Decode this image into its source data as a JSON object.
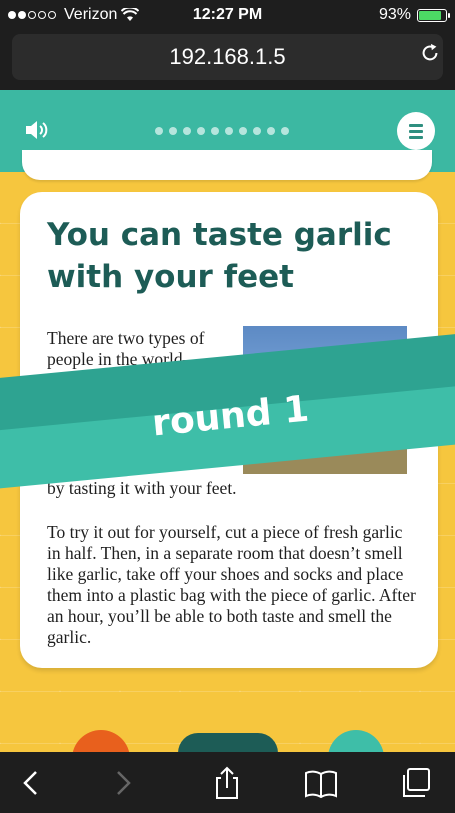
{
  "status_bar": {
    "carrier": "Verizon",
    "time": "12:27 PM",
    "battery": "93%",
    "battery_level": 0.93
  },
  "browser": {
    "address": "192.168.1.5"
  },
  "app_header": {
    "progress_steps": 10
  },
  "card": {
    "title": "You can taste garlic with your feet",
    "para1_top": "There are two types of people in the world— people who think the",
    "para1_bottom": "by tasting it with your feet.",
    "para2": "To try it out for yourself, cut a piece of fresh garlic in half. Then, in a separate room that doesn’t smell like garlic, take off your shoes and socks and place them into a plastic bag with the piece of garlic. After an hour, you’ll be able to both taste and smell the garlic."
  },
  "banner": {
    "label": "round 1"
  },
  "colors": {
    "header": "#3cb8a2",
    "title": "#1d5c56",
    "background": "#f6c63e",
    "banner_dark": "#2ea391",
    "banner_light": "#3ebea8",
    "reject": "#e8601d",
    "accept": "#3ebea8"
  }
}
